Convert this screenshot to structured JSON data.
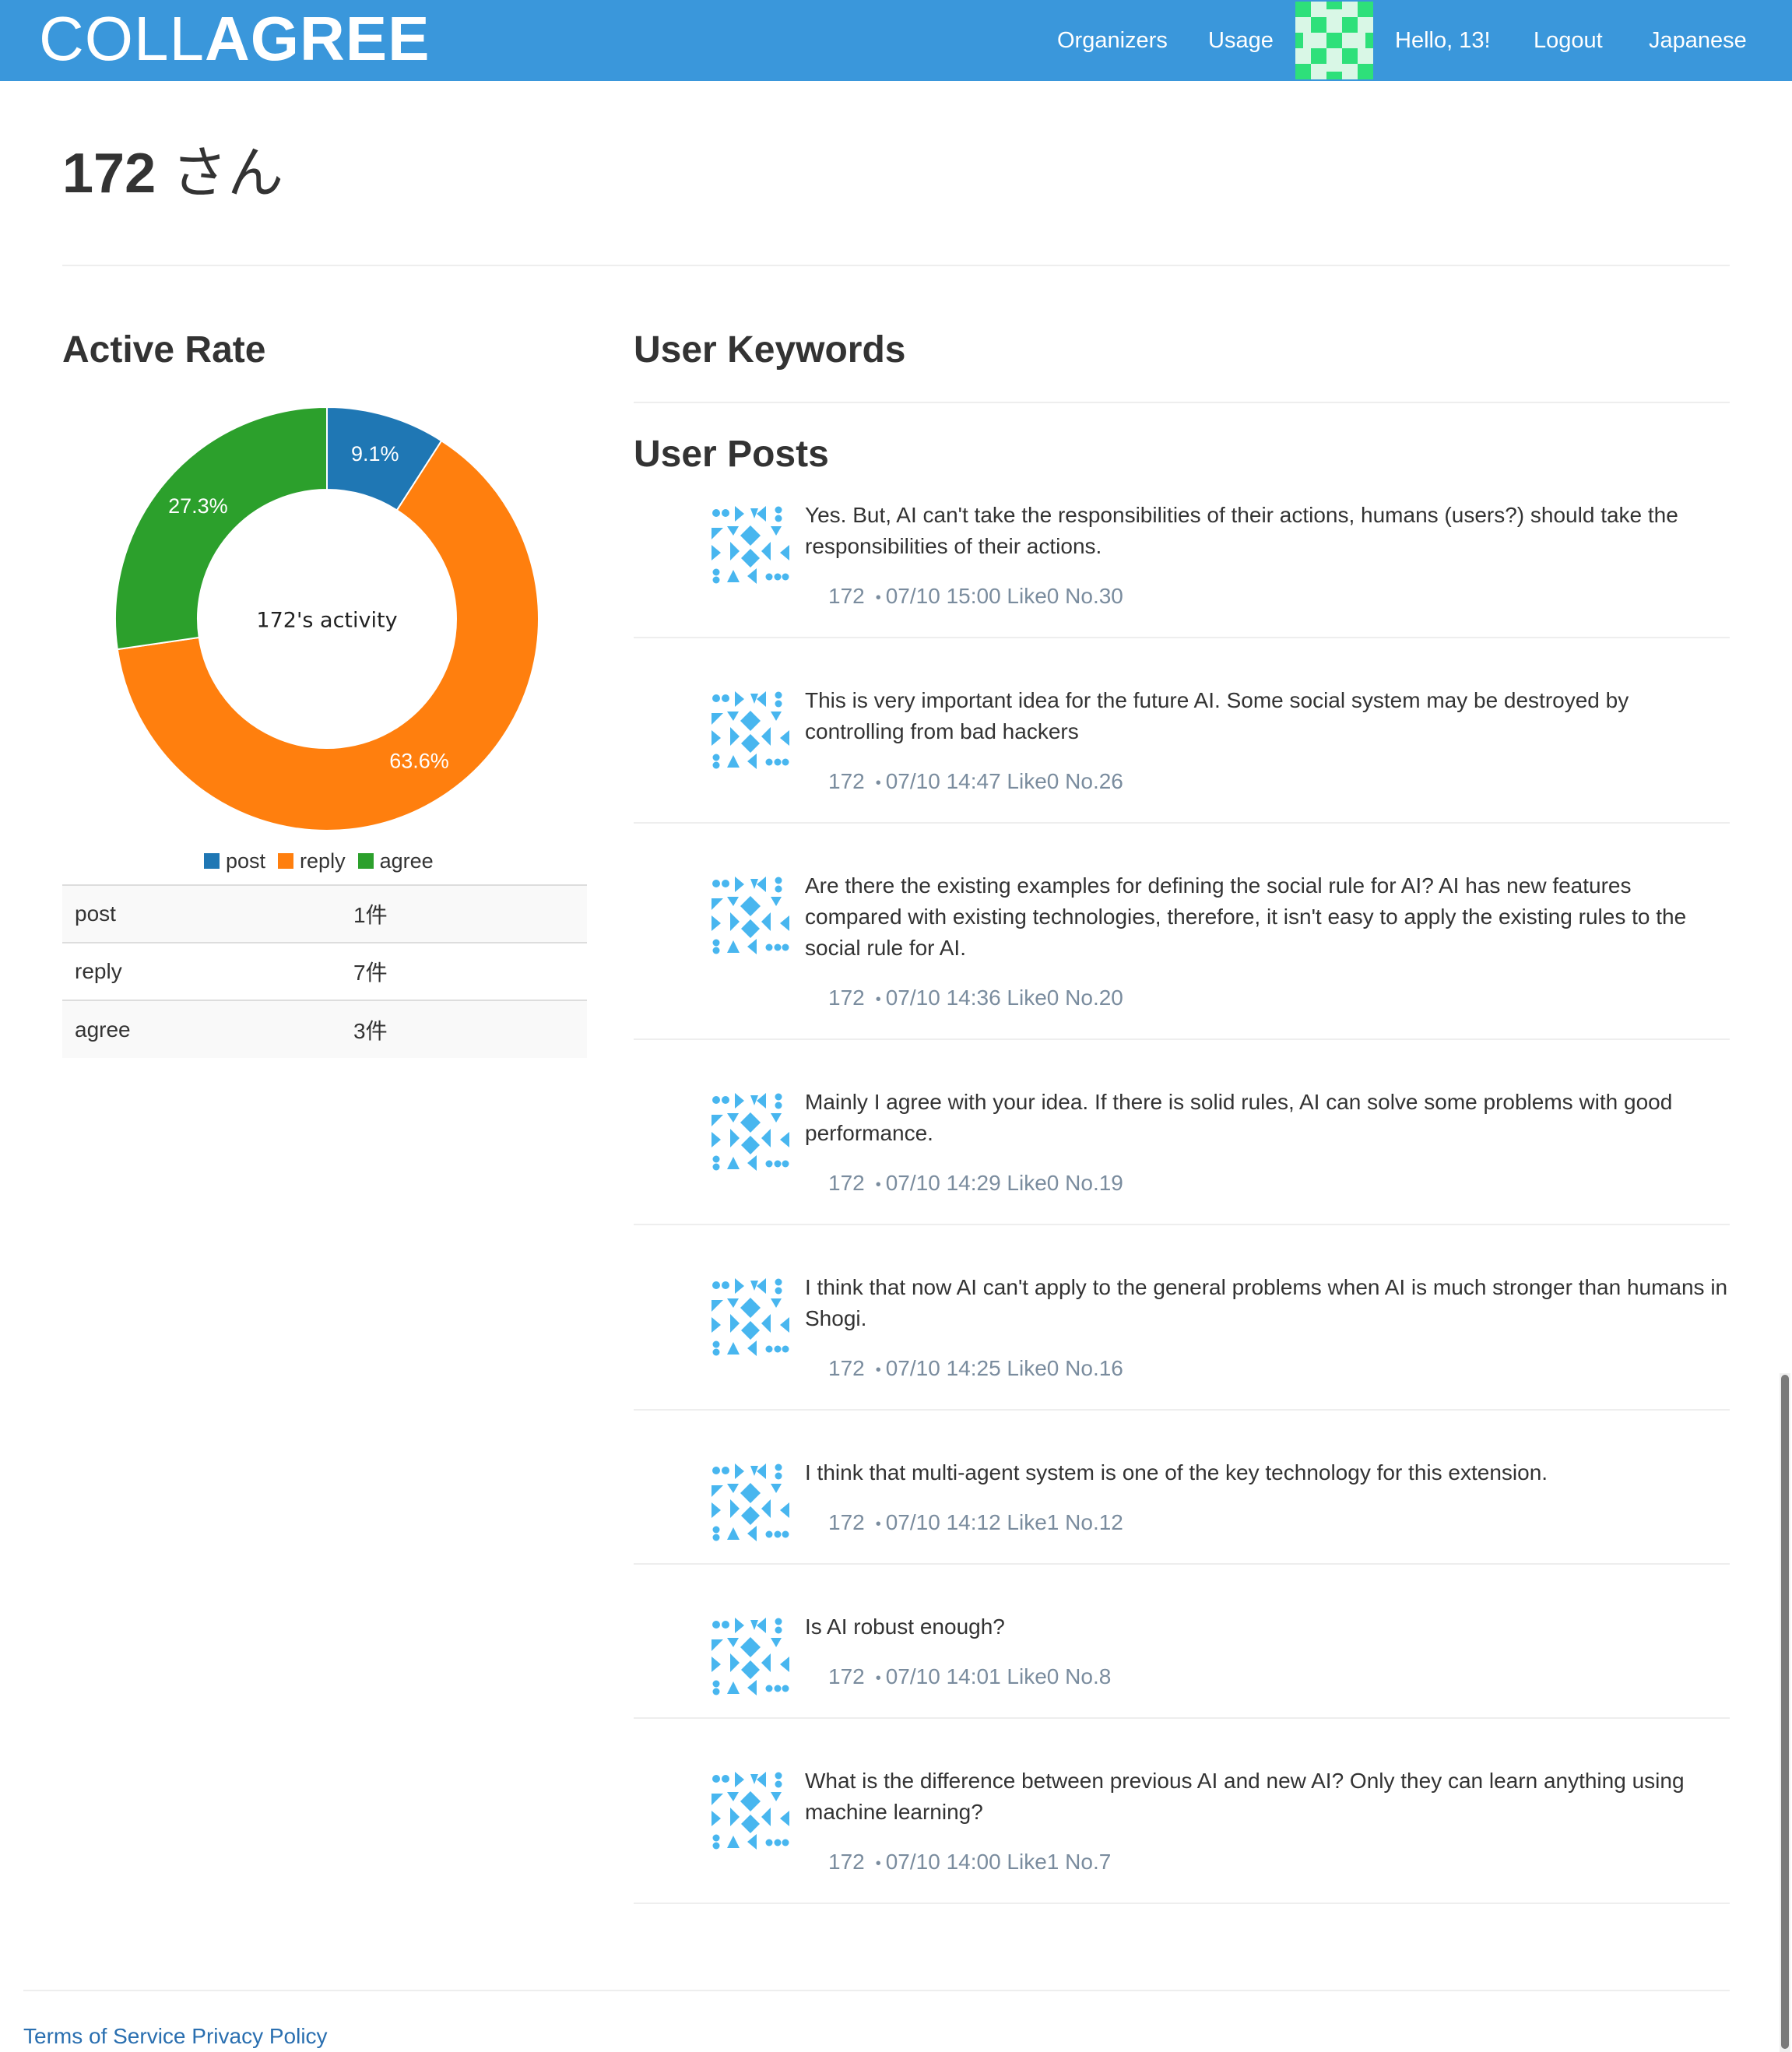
{
  "navbar": {
    "brand_light": "COLL",
    "brand_bold": "AGREE",
    "links": {
      "organizers": "Organizers",
      "usage": "Usage",
      "greeting": "Hello, 13!",
      "logout": "Logout",
      "language": "Japanese"
    },
    "avatar_icon": "identicon-avatar-icon",
    "color": "#3a97db"
  },
  "page": {
    "title_number": "172",
    "title_suffix": " さん"
  },
  "active_rate": {
    "heading": "Active Rate",
    "center_label": "172's activity",
    "legend": [
      "post",
      "reply",
      "agree"
    ],
    "table": [
      {
        "label": "post",
        "value": "1件"
      },
      {
        "label": "reply",
        "value": "7件"
      },
      {
        "label": "agree",
        "value": "3件"
      }
    ]
  },
  "chart_data": {
    "type": "pie",
    "variant": "donut",
    "categories": [
      "post",
      "reply",
      "agree"
    ],
    "values": [
      9.1,
      63.6,
      27.3
    ],
    "labels": [
      "9.1%",
      "63.6%",
      "27.3%"
    ],
    "colors": [
      "#1f77b4",
      "#ff7f0e",
      "#2ca02c"
    ],
    "center_text": "172's activity",
    "legend_position": "bottom"
  },
  "keywords": {
    "heading": "User Keywords"
  },
  "posts": {
    "heading": "User Posts",
    "items": [
      {
        "text": "Yes. But, AI can't take the responsibilities of their actions, humans (users?) should take the responsibilities of their actions.",
        "author": "172",
        "meta": "07/10 15:00 Like0 No.30"
      },
      {
        "text": "This is very important idea for the future AI. Some social system may be destroyed by controlling from bad hackers",
        "author": "172",
        "meta": "07/10 14:47 Like0 No.26"
      },
      {
        "text": "Are there the existing examples for defining the social rule for AI? AI has new features compared with existing technologies, therefore, it isn't easy to apply the existing rules to the social rule for AI.",
        "author": "172",
        "meta": "07/10 14:36 Like0 No.20"
      },
      {
        "text": "Mainly I agree with your idea. If there is solid rules, AI can solve some problems with good performance.",
        "author": "172",
        "meta": "07/10 14:29 Like0 No.19"
      },
      {
        "text": "I think that now AI can't apply to the general problems when AI is much stronger than humans in Shogi.",
        "author": "172",
        "meta": "07/10 14:25 Like0 No.16"
      },
      {
        "text": "I think that multi-agent system is one of the key technology for this extension.",
        "author": "172",
        "meta": "07/10 14:12 Like1 No.12"
      },
      {
        "text": "Is AI robust enough?",
        "author": "172",
        "meta": "07/10 14:01 Like0 No.8"
      },
      {
        "text": "What is the difference between previous AI and new AI? Only they can learn anything using machine learning?",
        "author": "172",
        "meta": "07/10 14:00 Like1 No.7"
      }
    ]
  },
  "footer": {
    "terms": "Terms of Service",
    "privacy": "Privacy Policy"
  }
}
